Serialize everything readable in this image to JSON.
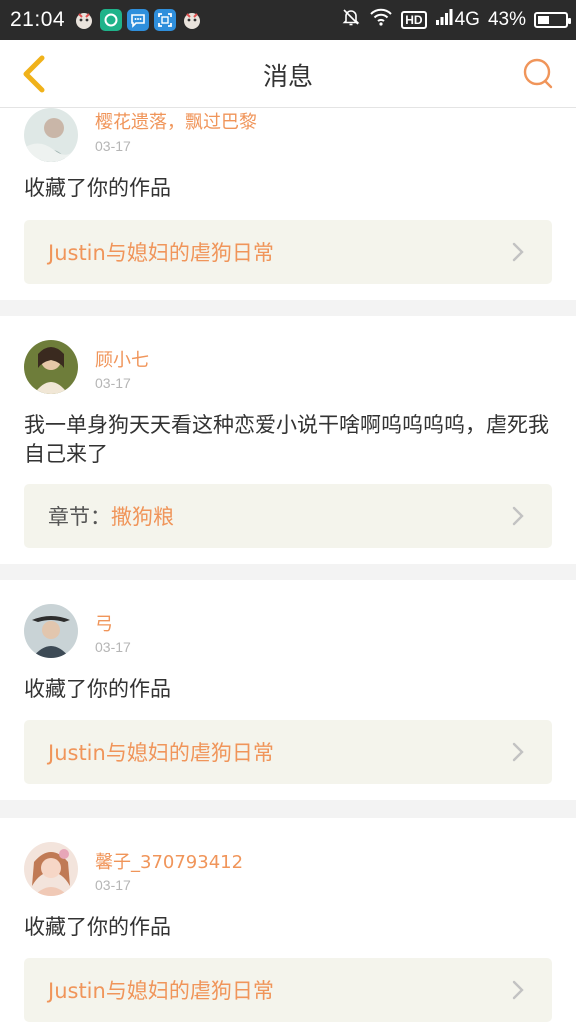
{
  "status_bar": {
    "time": "21:04",
    "network": "4G",
    "hd_label": "HD",
    "battery_percent": "43%",
    "battery_level": 0.43,
    "icons": [
      "notification-app-icon",
      "app-green-icon",
      "chat-app-icon",
      "scan-app-icon",
      "notification-app-icon",
      "mute-bell-icon",
      "wifi-icon",
      "hd-icon",
      "signal-icon",
      "battery-icon"
    ]
  },
  "header": {
    "title": "消息",
    "back_icon": "chevron-left-icon",
    "search_icon": "search-icon",
    "accent_color": "#f0955a"
  },
  "messages": [
    {
      "username": "樱花遗落，飘过巴黎",
      "date": "03-17",
      "text": "收藏了你的作品",
      "ref_prefix": "",
      "ref_text": "Justin与媳妇的虐狗日常"
    },
    {
      "username": "顾小七",
      "date": "03-17",
      "text": "我一单身狗天天看这种恋爱小说干啥啊呜呜呜呜，虐死我自己来了",
      "ref_prefix": "章节：",
      "ref_text": "撒狗粮"
    },
    {
      "username": "弓",
      "date": "03-17",
      "text": "收藏了你的作品",
      "ref_prefix": "",
      "ref_text": "Justin与媳妇的虐狗日常"
    },
    {
      "username": "馨子_370793412",
      "date": "03-17",
      "text": "收藏了你的作品",
      "ref_prefix": "",
      "ref_text": "Justin与媳妇的虐狗日常"
    }
  ]
}
